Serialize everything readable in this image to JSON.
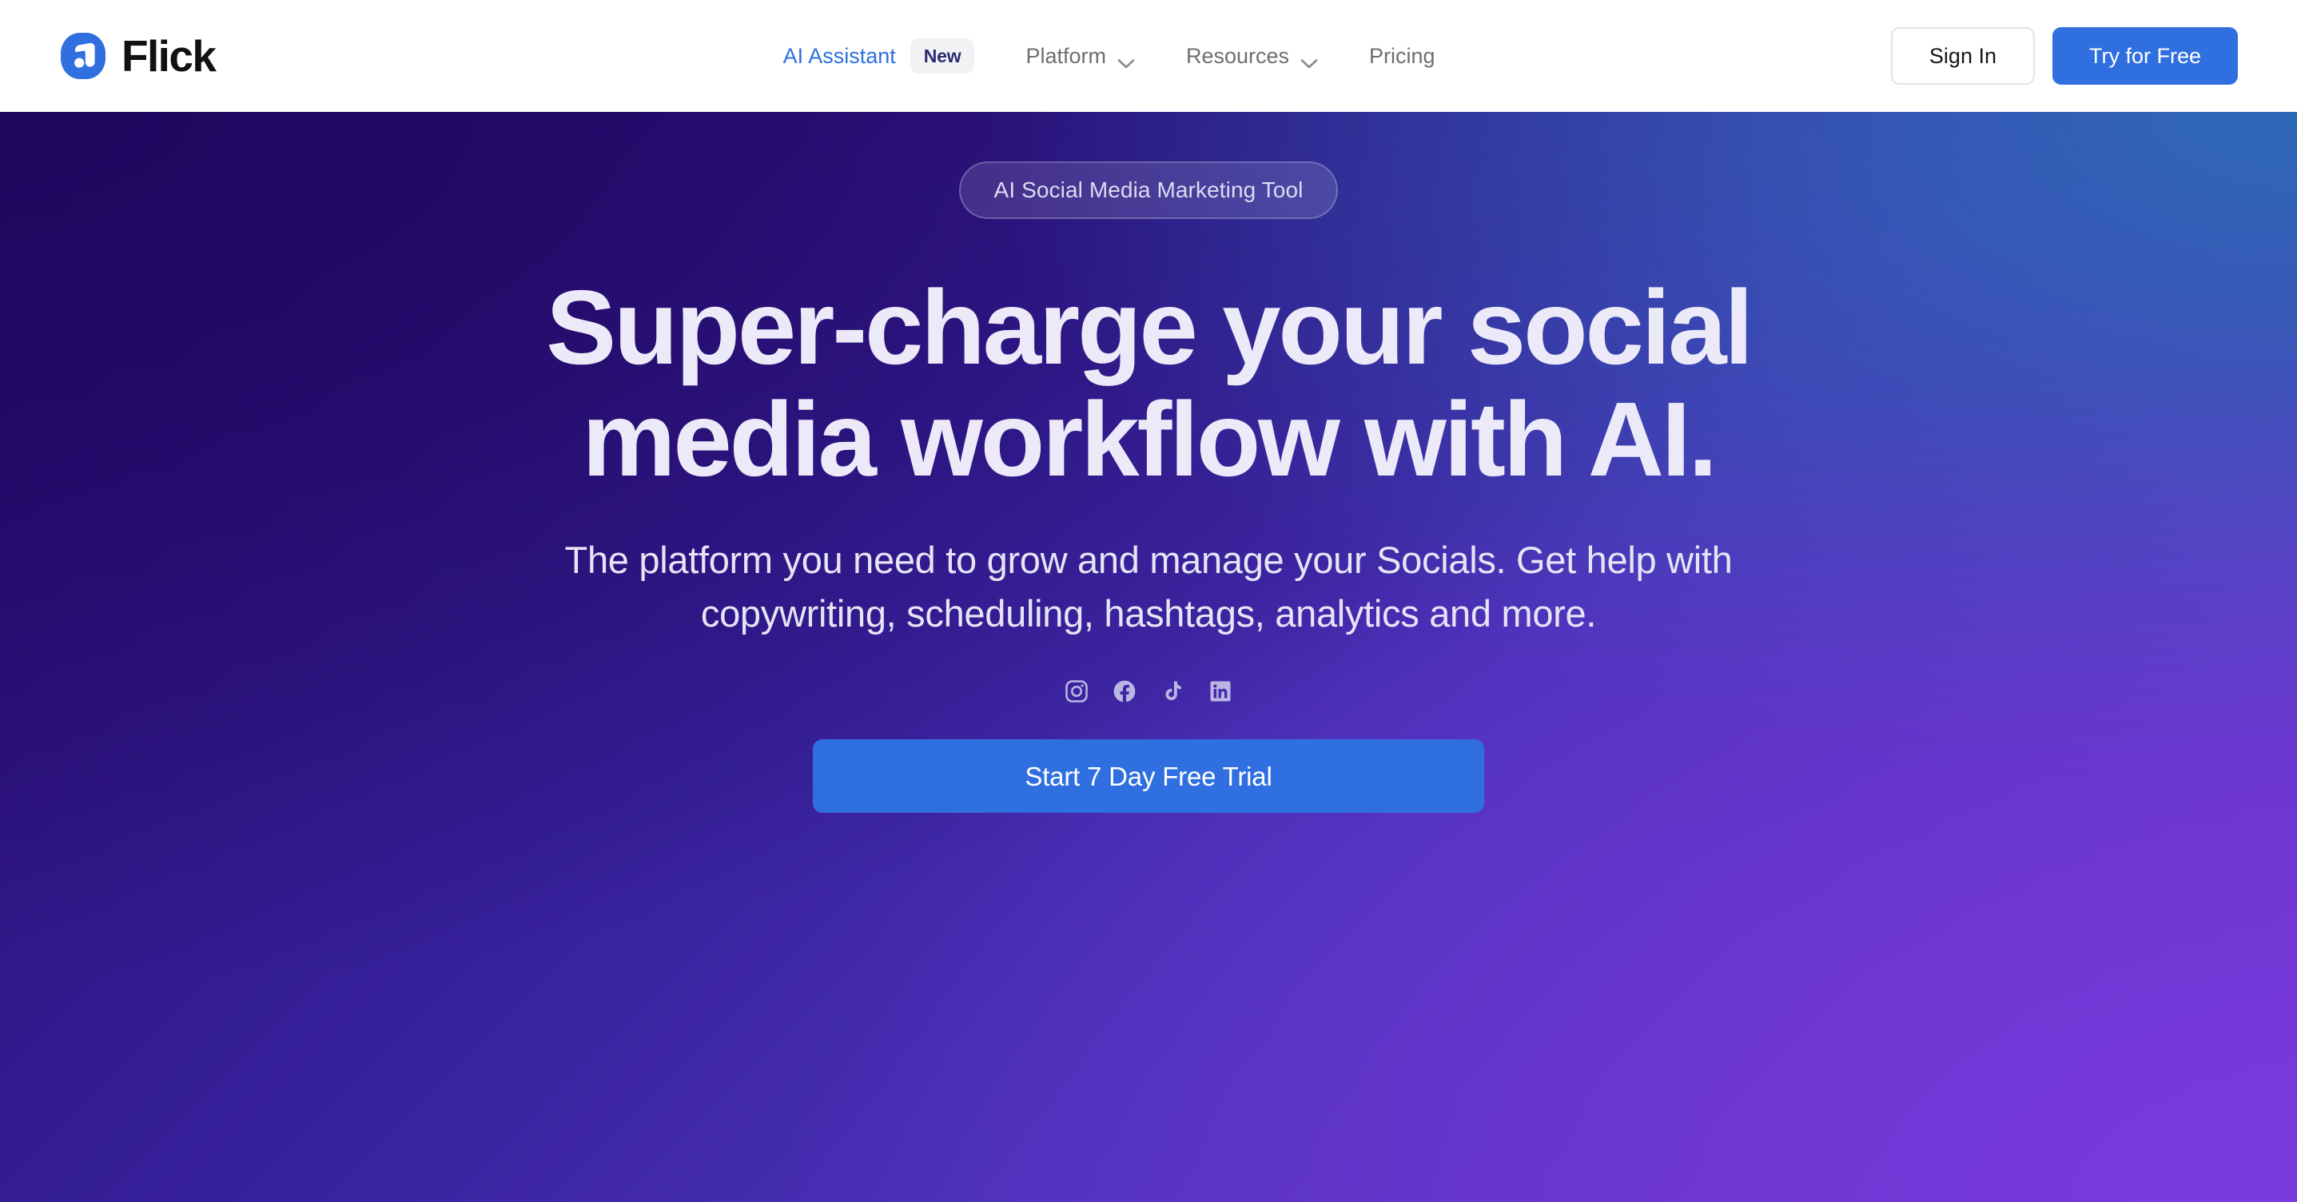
{
  "header": {
    "brand": {
      "name": "Flick",
      "logo_icon": "flick-logo-icon",
      "logo_color": "#2f6fe0"
    },
    "nav": [
      {
        "label": "AI Assistant",
        "badge": "New",
        "has_chevron": false,
        "active": true
      },
      {
        "label": "Platform",
        "badge": null,
        "has_chevron": true,
        "active": false
      },
      {
        "label": "Resources",
        "badge": null,
        "has_chevron": true,
        "active": false
      },
      {
        "label": "Pricing",
        "badge": null,
        "has_chevron": false,
        "active": false
      }
    ],
    "actions": {
      "sign_in_label": "Sign In",
      "try_free_label": "Try for Free"
    }
  },
  "hero": {
    "pill_label": "AI Social Media Marketing Tool",
    "title_line_1": "Super-charge your social",
    "title_line_2": "media workflow with AI.",
    "subtitle": "The platform you need to grow and manage your Socials. Get help with copywriting, scheduling, hashtags, analytics and more.",
    "socials": [
      {
        "name": "instagram-icon",
        "label": "Instagram"
      },
      {
        "name": "facebook-icon",
        "label": "Facebook"
      },
      {
        "name": "tiktok-icon",
        "label": "TikTok"
      },
      {
        "name": "linkedin-icon",
        "label": "LinkedIn"
      }
    ],
    "cta_label": "Start 7 Day Free Trial",
    "colors": {
      "accent_blue": "#2f6fe0",
      "gradient_top_left": "#230765",
      "gradient_top_right": "#2c5fa8",
      "gradient_bottom_left": "#371280",
      "gradient_bottom_right": "#6633c4",
      "pill_text": "#dcdcf2",
      "title_text": "#eceaf8"
    }
  }
}
